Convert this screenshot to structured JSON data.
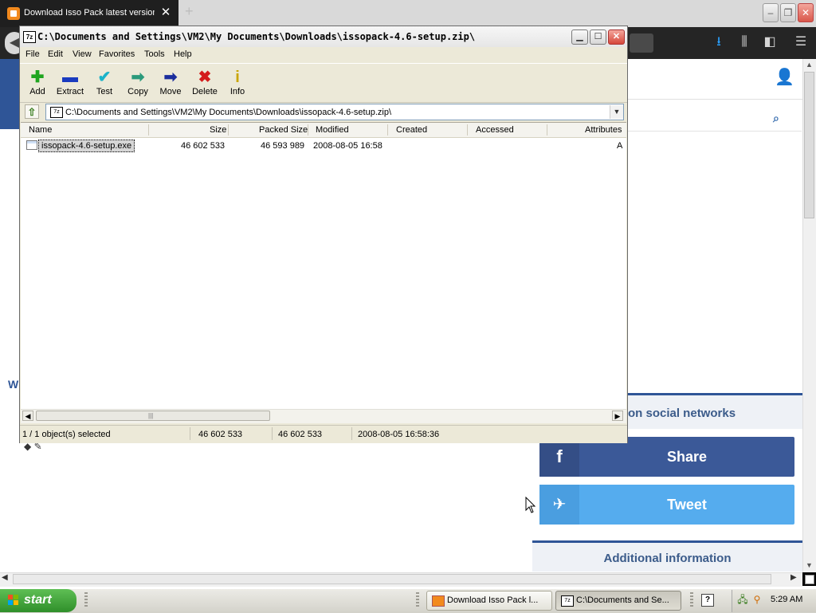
{
  "browser": {
    "tab_title": "Download Isso Pack latest version",
    "tab_close": "✕",
    "new_tab": "+",
    "window_buttons": {
      "minimize": "–",
      "restore": "❐",
      "close": "✕"
    }
  },
  "webpage": {
    "w_fragment": "W",
    "social_heading": "on social networks",
    "share_label": "Share",
    "share_icon": "f",
    "tweet_label": "Tweet",
    "tweet_icon": "🐦",
    "additional_info": "Additional information"
  },
  "zip_window": {
    "title": "C:\\Documents and Settings\\VM2\\My Documents\\Downloads\\issopack-4.6-setup.zip\\",
    "menu": [
      "File",
      "Edit",
      "View",
      "Favorites",
      "Tools",
      "Help"
    ],
    "toolbar": [
      {
        "label": "Add",
        "icon": "add-icon",
        "glyph": "✚",
        "color": "#1fa51f"
      },
      {
        "label": "Extract",
        "icon": "extract-icon",
        "glyph": "▬",
        "color": "#1a3bbf"
      },
      {
        "label": "Test",
        "icon": "test-icon",
        "glyph": "✔",
        "color": "#1bb3c9"
      },
      {
        "label": "Copy",
        "icon": "copy-icon",
        "glyph": "➡",
        "color": "#2b9a7b"
      },
      {
        "label": "Move",
        "icon": "move-icon",
        "glyph": "➡",
        "color": "#1a2d9c"
      },
      {
        "label": "Delete",
        "icon": "delete-icon",
        "glyph": "✖",
        "color": "#d41b1b"
      },
      {
        "label": "Info",
        "icon": "info-icon",
        "glyph": "i",
        "color": "#c9a400"
      }
    ],
    "address": "C:\\Documents and Settings\\VM2\\My Documents\\Downloads\\issopack-4.6-setup.zip\\",
    "columns": [
      "Name",
      "Size",
      "Packed Size",
      "Modified",
      "Created",
      "Accessed",
      "Attributes"
    ],
    "rows": [
      {
        "name": "issopack-4.6-setup.exe",
        "size": "46 602 533",
        "packed": "46 593 989",
        "modified": "2008-08-05 16:58",
        "created": "",
        "accessed": "",
        "attributes": "A"
      }
    ],
    "status": {
      "selected": "1 / 1 object(s) selected",
      "size": "46 602 533",
      "packed": "46 602 533",
      "modified": "2008-08-05 16:58:36"
    }
  },
  "taskbar": {
    "start_label": "start",
    "tasks": [
      {
        "label": "Download Isso Pack l...",
        "active": false
      },
      {
        "label": "C:\\Documents and Se...",
        "active": true
      }
    ],
    "help_icon": "?",
    "clock": "5:29 AM"
  },
  "colors": {
    "facebook": "#3b5998",
    "twitter": "#55acee",
    "page_accent": "#2f5597",
    "xp_start_green": "#3c9e35"
  }
}
